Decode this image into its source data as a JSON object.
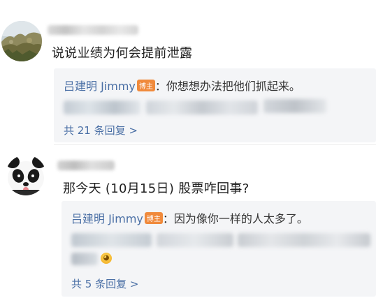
{
  "comments": [
    {
      "text": "说说业绩为何会提前泄露",
      "reply": {
        "author": "吕建明 Jimmy",
        "badge": "博主",
        "text": "：你想想办法把他们抓起来。"
      },
      "more_replies": "共 21 条回复 >"
    },
    {
      "text": "那今天 (10月15日) 股票咋回事?",
      "reply": {
        "author": "吕建明 Jimmy",
        "badge": "博主",
        "text": "：因为像你一样的人太多了。"
      },
      "more_replies": "共 5 条回复 >"
    }
  ],
  "icons": {
    "emoji": "laughing-emoji-icon"
  },
  "colors": {
    "link": "#4a6fa5",
    "badge": "#f08a3c",
    "reply_bg": "#f4f5f7"
  }
}
